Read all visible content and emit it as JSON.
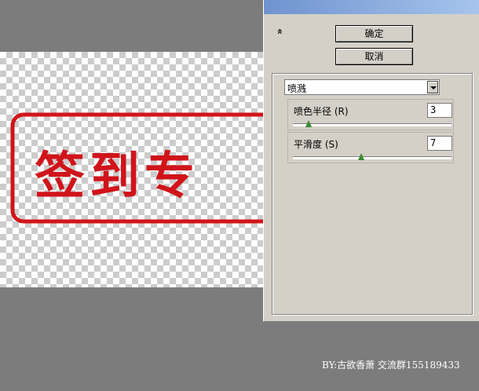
{
  "dialog": {
    "collapse_glyph": "»",
    "ok_label": "确定",
    "cancel_label": "取消",
    "filter_select": {
      "value": "喷溅"
    },
    "params": [
      {
        "label": "喷色半径 (R)",
        "value": "3",
        "slider_fraction": 0.1
      },
      {
        "label": "平滑度 (S)",
        "value": "7",
        "slider_fraction": 0.43
      }
    ]
  },
  "canvas": {
    "stamp_text": "签到专",
    "stamp_color": "#d0141a",
    "checker_light": "#ffffff",
    "checker_dark": "#cccccc"
  },
  "footer": {
    "credit": "BY:古欲香萧  交流群155189433"
  },
  "colors": {
    "background": "#7c7c7c",
    "panel": "#d4d0c8",
    "slider_thumb": "#3a8a2e"
  }
}
